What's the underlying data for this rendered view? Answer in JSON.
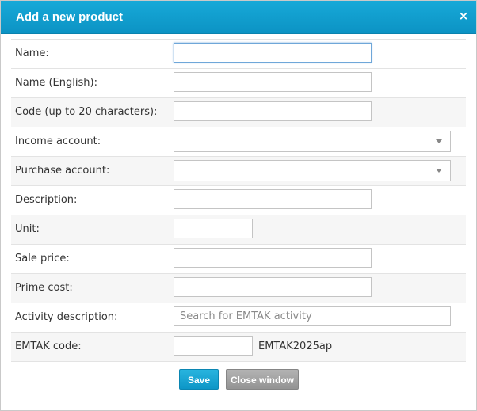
{
  "dialog": {
    "title": "Add a new product",
    "close_icon": "close-icon",
    "close_glyph": "×"
  },
  "form": {
    "name": {
      "label": "Name:",
      "value": ""
    },
    "name_english": {
      "label": "Name (English):",
      "value": ""
    },
    "code": {
      "label": "Code (up to 20 characters):",
      "value": ""
    },
    "income_account": {
      "label": "Income account:",
      "value": ""
    },
    "purchase_account": {
      "label": "Purchase account:",
      "value": ""
    },
    "description": {
      "label": "Description:",
      "value": ""
    },
    "unit": {
      "label": "Unit:",
      "value": ""
    },
    "sale_price": {
      "label": "Sale price:",
      "value": ""
    },
    "prime_cost": {
      "label": "Prime cost:",
      "value": ""
    },
    "activity_description": {
      "label": "Activity description:",
      "value": "",
      "placeholder": "Search for EMTAK activity"
    },
    "emtak_code": {
      "label": "EMTAK code:",
      "value": "",
      "suffix": "EMTAK2025ap"
    }
  },
  "buttons": {
    "save_label": "Save",
    "close_label": "Close window"
  },
  "colors": {
    "titlebar": "#0c93c4",
    "save_button": "#0d96c7",
    "close_button": "#939393"
  }
}
